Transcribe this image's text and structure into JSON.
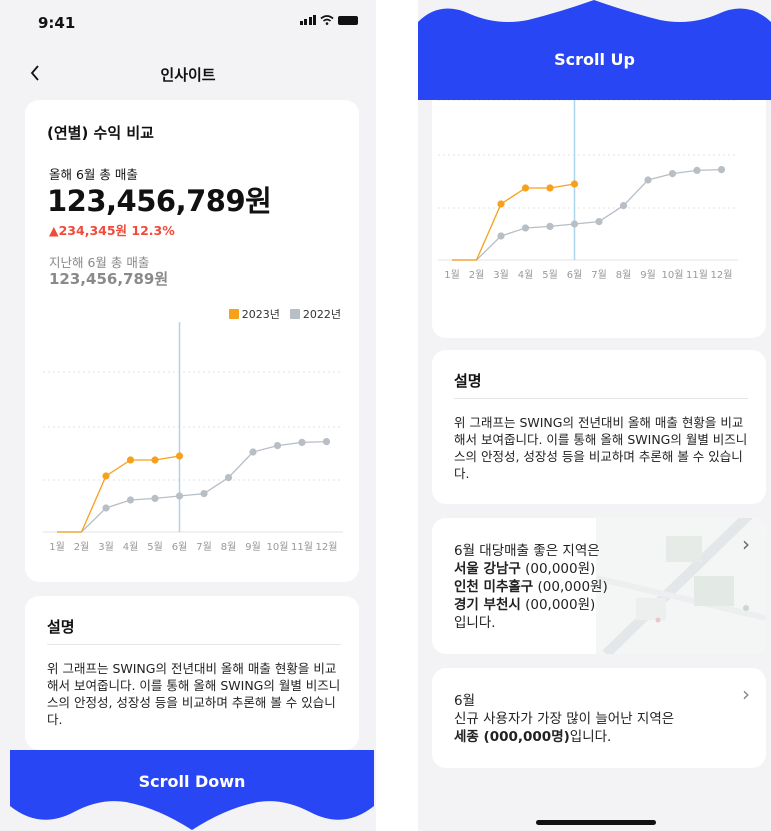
{
  "status": {
    "time": "9:41"
  },
  "nav": {
    "title": "인사이트"
  },
  "chart_card": {
    "title": "(연별) 수익 비교",
    "this_year_label": "올해 6월 총 매출",
    "this_year_value": "123,456,789원",
    "change": "▲234,345원 12.3%",
    "last_year_label": "지난해 6월 총 매출",
    "last_year_value": "123,456,789원"
  },
  "chart_data": {
    "type": "line",
    "categories": [
      "1월",
      "2월",
      "3월",
      "4월",
      "5월",
      "6월",
      "7월",
      "8월",
      "9월",
      "10월",
      "11월",
      "12월"
    ],
    "series": [
      {
        "name": "2023년",
        "color": "#F7A01C",
        "values": [
          0,
          0,
          70,
          90,
          90,
          95,
          null,
          null,
          null,
          null,
          null,
          null
        ]
      },
      {
        "name": "2022년",
        "color": "#B8BEC6",
        "values": [
          0,
          0,
          30,
          40,
          42,
          45,
          48,
          68,
          100,
          108,
          112,
          113
        ]
      }
    ],
    "ylim": [
      0,
      200
    ],
    "highlight_category": "6월",
    "grid": true,
    "legend_position": "top-right"
  },
  "description": {
    "title": "설명",
    "text": "위 그래프는 SWING의 전년대비 올해 매출 현황을 비교해서 보여줍니다. 이를 통해 올해 SWING의 월별 비즈니스의 안정성, 성장성 등을 비교하며 추론해 볼 수 있습니다."
  },
  "region_card": {
    "line1": "6월 대당매출 좋은 지역은",
    "items": [
      {
        "name": "서울 강남구",
        "value": " (00,000원)"
      },
      {
        "name": "인천 미추홀구",
        "value": " (00,000원)"
      },
      {
        "name": "경기 부천시",
        "value": " (00,000원)"
      }
    ],
    "tail": "입니다.",
    "arrow": "›"
  },
  "user_card": {
    "line1": "6월",
    "line2": "신규 사용자가 가장 많이 늘어난 지역은",
    "highlight": "세종 (000,000명)",
    "tail": "입니다.",
    "arrow": "›"
  },
  "buttons": {
    "scroll_down": "Scroll Down",
    "scroll_up": "Scroll Up"
  },
  "colors": {
    "accent": "#2946F4",
    "orange": "#F7A01C",
    "gray": "#B8BEC6",
    "highlight_line": "#A9D6EE"
  }
}
